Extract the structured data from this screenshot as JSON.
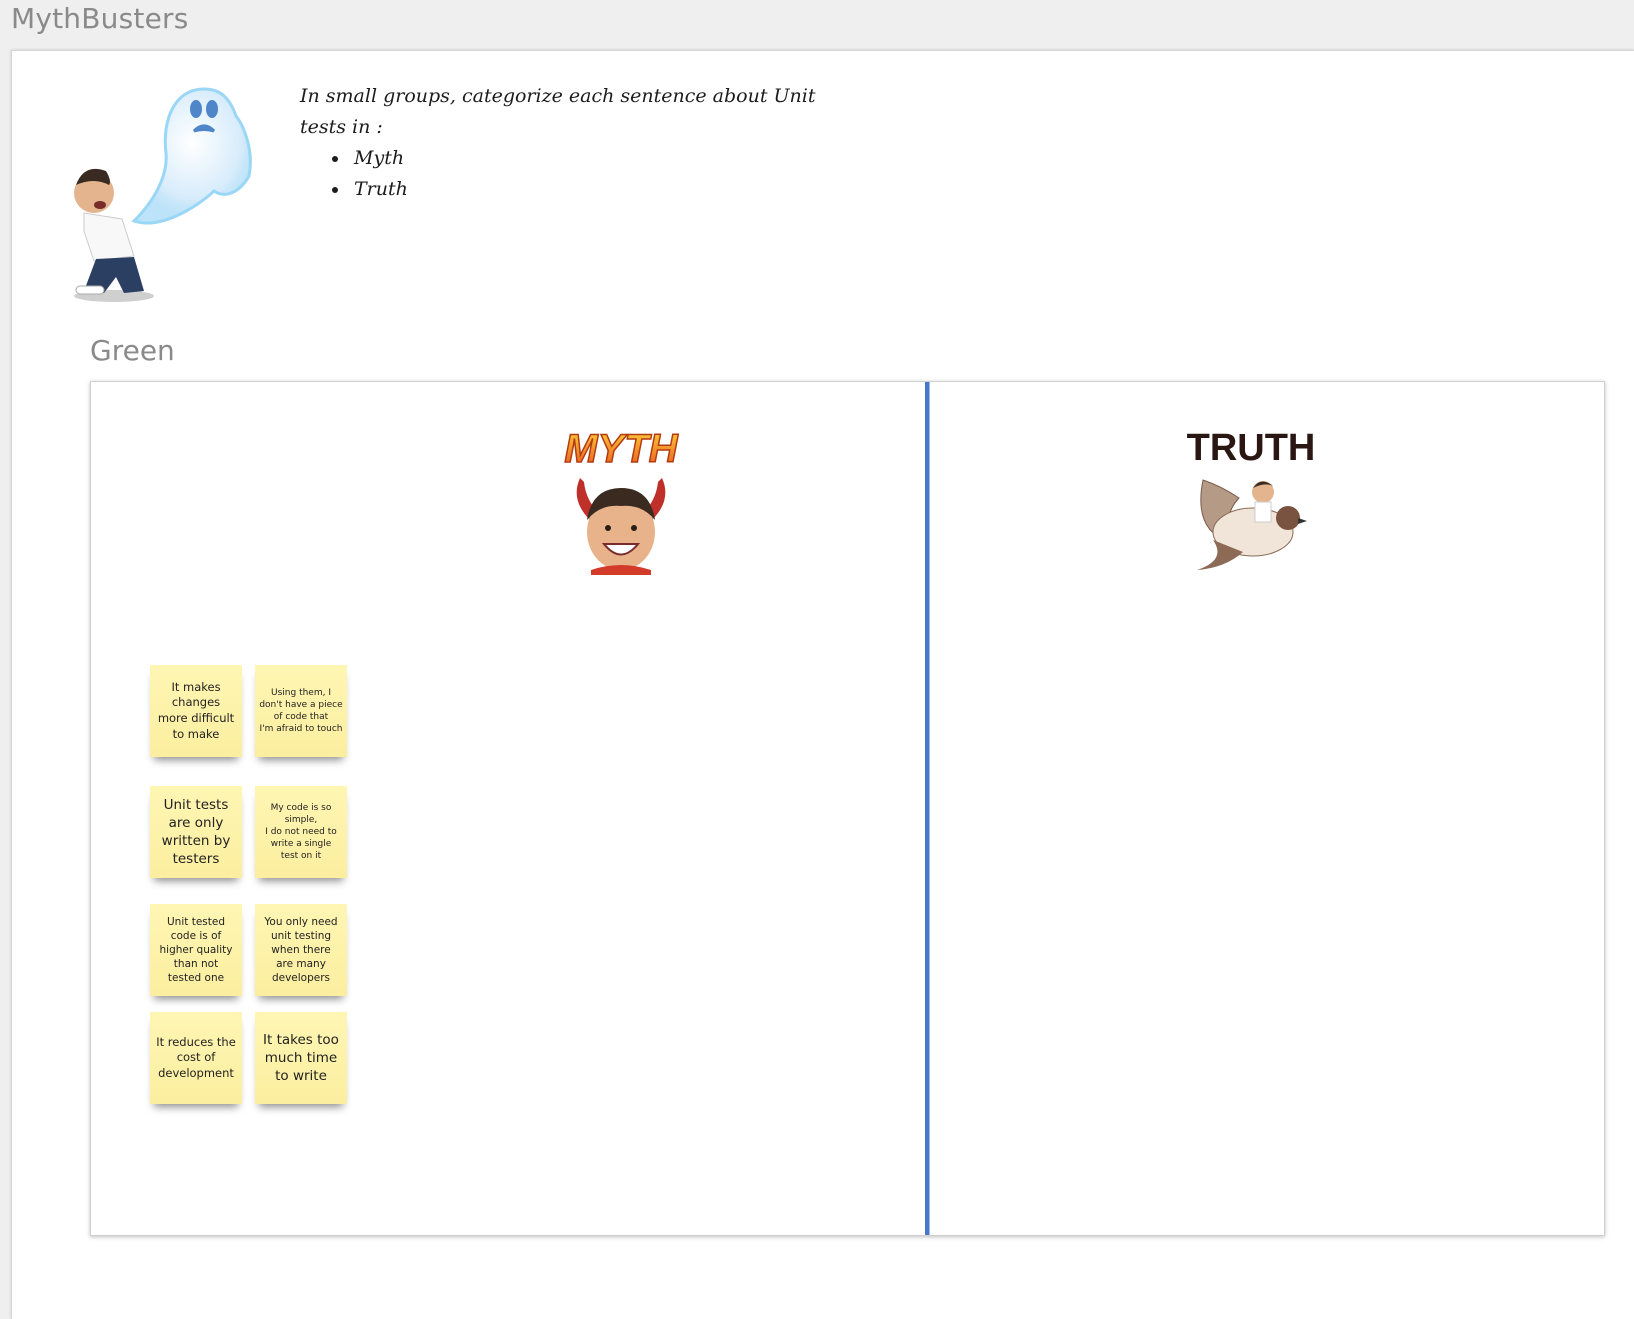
{
  "app": {
    "title": "MythBusters"
  },
  "instructions": {
    "text": "In small groups, categorize each sentence about Unit tests in :",
    "options": [
      "Myth",
      "Truth"
    ]
  },
  "section": {
    "title": "Green"
  },
  "columns": {
    "myth": {
      "label": "MYTH"
    },
    "truth": {
      "label": "TRUTH"
    }
  },
  "stickies": [
    {
      "text": "It makes\nchanges\nmore difficult\nto make"
    },
    {
      "text": "Using them, I\ndon't have a piece\nof code that\nI'm afraid to touch"
    },
    {
      "text": "Unit tests\nare only\nwritten by\ntesters"
    },
    {
      "text": "My code is so\nsimple,\nI do not need to\nwrite a single\ntest on it"
    },
    {
      "text": "Unit tested\ncode is of\nhigher quality\nthan not\ntested one"
    },
    {
      "text": "You only need\nunit testing\nwhen there\nare many\ndevelopers"
    },
    {
      "text": "It reduces the\ncost of\ndevelopment"
    },
    {
      "text": "It takes too\nmuch time\nto write"
    }
  ],
  "colors": {
    "sticky": "#fbee9f",
    "divider": "#4a78c8",
    "title_gray": "#8a8a8a"
  }
}
